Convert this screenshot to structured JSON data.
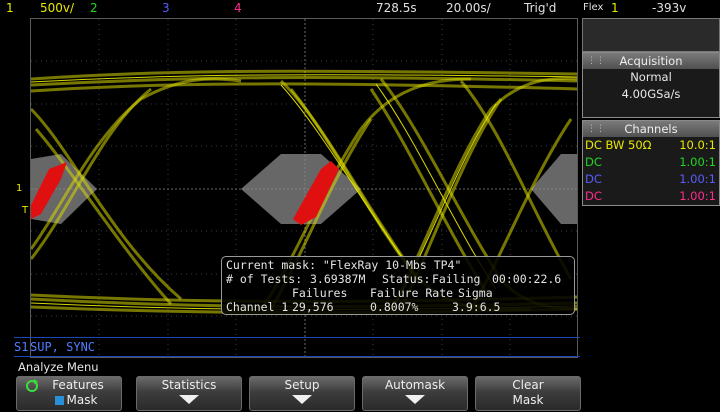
{
  "topbar": {
    "ch1_num": "1",
    "ch1_scale": "500v/",
    "ch2_num": "2",
    "ch3_num": "3",
    "ch4_num": "4",
    "time_ref": "728.5s",
    "time_scale": "20.00s/",
    "trig_status": "Trig'd",
    "trig_source_label": "Flex",
    "trig_channel": "1",
    "trig_level": "-393v"
  },
  "mask": {
    "current_mask": "Current mask: \"FlexRay 10-Mbs TP4\"",
    "tests_label": "# of Tests:",
    "tests_value": "3.69387M",
    "status_label": "Status:",
    "status_value": "Failing",
    "elapsed": "00:00:22.6",
    "col_failures": "Failures",
    "col_rate": "Failure Rate",
    "col_sigma": "Sigma",
    "row_channel": "Channel 1",
    "row_failures": "29,576",
    "row_rate": "0.8007%",
    "row_sigma": "3.9:6.5"
  },
  "decode": {
    "label": "S1",
    "text": "SUP, SYNC"
  },
  "acquisition": {
    "title": "Acquisition",
    "mode": "Normal",
    "rate": "4.00GSa/s"
  },
  "channels": {
    "title": "Channels",
    "rows": [
      {
        "coupling": "DC BW 50Ω",
        "probe": "10.0:1",
        "color": "#e8e800"
      },
      {
        "coupling": "DC",
        "probe": "1.00:1",
        "color": "#1fd81f"
      },
      {
        "coupling": "DC",
        "probe": "1.00:1",
        "color": "#5b5bff"
      },
      {
        "coupling": "DC",
        "probe": "1.00:1",
        "color": "#ff2d8a"
      }
    ]
  },
  "menu": {
    "title": "Analyze Menu",
    "softkeys": [
      {
        "label": "Features",
        "sub": "Mask"
      },
      {
        "label": "Statistics",
        "sub": ""
      },
      {
        "label": "Setup",
        "sub": ""
      },
      {
        "label": "Automask",
        "sub": ""
      },
      {
        "label": "Clear",
        "sub": "Mask"
      }
    ]
  },
  "markers": {
    "ch1_ground": "1",
    "trigger": "T"
  },
  "colors": {
    "channel1": "#e8e800",
    "mask_region": "#8a8a8a",
    "violation": "#e01010",
    "decode": "#4f7dff"
  }
}
